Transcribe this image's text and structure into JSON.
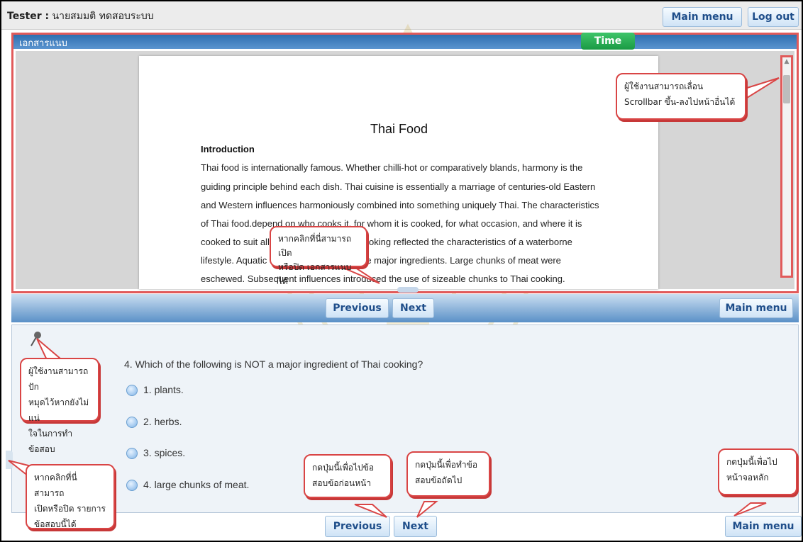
{
  "header": {
    "tester_label": "Tester :",
    "tester_name": "นายสมมติ ทดสอบระบบ",
    "main_menu_label": "Main menu",
    "logout_label": "Log out"
  },
  "document_panel": {
    "title": "เอกสารแนบ",
    "time_label": "Time",
    "paper": {
      "title": "Thai Food",
      "intro_heading": "Introduction",
      "lines": [
        "Thai food is internationally famous. Whether chilli-hot or comparatively blands, harmony is the",
        "guiding principle behind each dish. Thai cuisine is essentially a marriage of centuries-old Eastern",
        "and Western influences harmoniously combined into something uniquely Thai. The characteristics",
        "of Thai food.depend on who cooks it, for whom it is cooked, for what occasion, and where it is",
        "cooked to suit all",
        "lifestyle. Aquatic",
        "eschewed. Subsequent influences introduced the use of sizeable chunks to Thai cooking."
      ],
      "line5_tail": "oking reflected the characteristics of a waterborne",
      "line6_tail": "re major ingredients. Large chunks of meat were"
    }
  },
  "nav_top": {
    "previous_label": "Previous",
    "next_label": "Next",
    "main_menu_label": "Main menu"
  },
  "question": {
    "text": "4.  Which of the following is NOT a major ingredient of Thai cooking?",
    "options": [
      "1.  plants.",
      "2.  herbs.",
      "3.  spices.",
      "4.  large chunks of meat."
    ]
  },
  "nav_bottom": {
    "previous_label": "Previous",
    "next_label": "Next",
    "main_menu_label": "Main menu"
  },
  "callouts": {
    "scrollbar": [
      "ผู้ใช้งานสามารถเลื่อน",
      "Scrollbar ขึ้น-ลงไปหน้าอื่นได้"
    ],
    "toggle_doc": [
      "หากคลิกที่นี่สามารถเปิด",
      "หรือปิด เอกสารแนบได้"
    ],
    "pin": [
      "ผู้ใช้งานสามารถปัก",
      "หมุดไว้หากยังไม่แน่",
      "ใจในการทำข้อสอบ"
    ],
    "toggle_list": [
      "หากคลิกที่นี่สามารถ",
      "เปิดหรือปิด รายการ",
      "ข้อสอบนี้ได้"
    ],
    "previous": [
      "กดปุ่มนี้เพื่อไปข้อ",
      "สอบข้อก่อนหน้า"
    ],
    "next": [
      "กดปุ่มนี้เพื่อทำข้อ",
      "สอบข้อถัดไป"
    ],
    "main_menu": [
      "กดปุ่มนี้เพื่อไป",
      "หน้าจอหลัก"
    ]
  },
  "colors": {
    "callout_border": "#d94545",
    "header_blue": "#2f6fb0",
    "time_green": "#1a9a44",
    "button_text": "#1f4e8a"
  }
}
